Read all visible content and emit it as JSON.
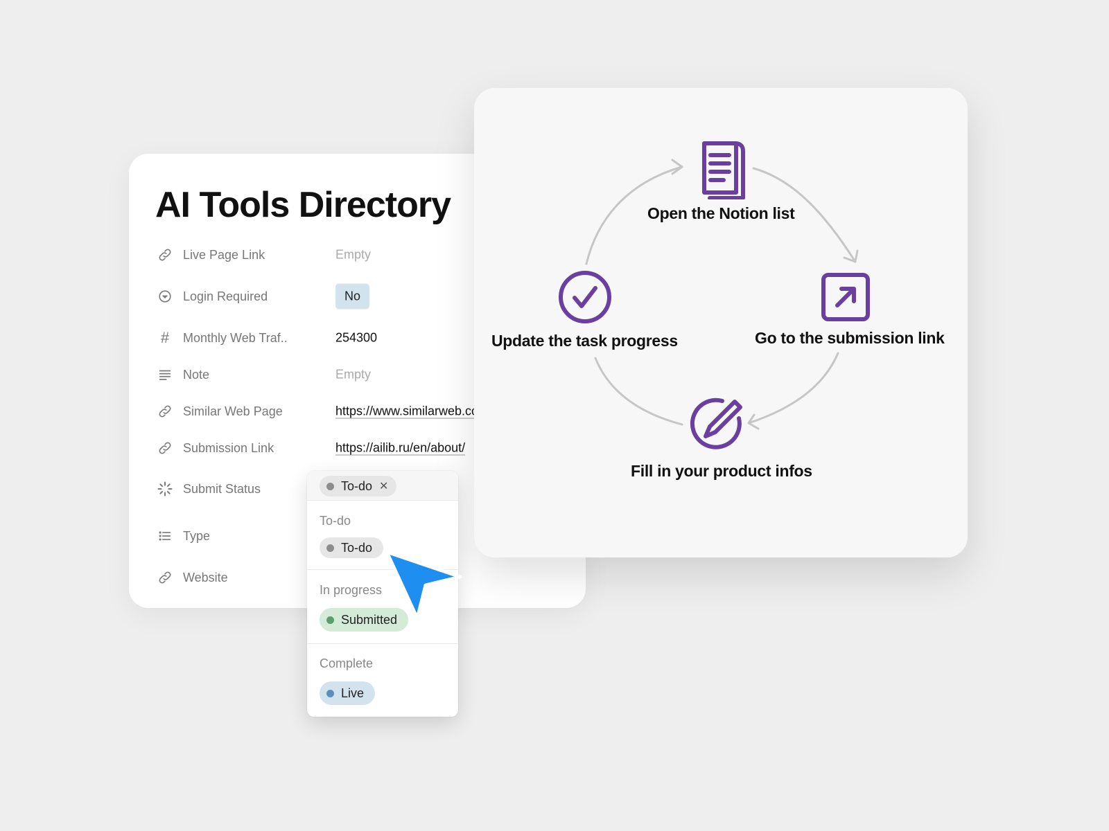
{
  "database": {
    "title": "AI Tools Directory",
    "properties": [
      {
        "icon": "link-icon",
        "label": "Live Page Link",
        "value": "Empty"
      },
      {
        "icon": "chevron-circle-icon",
        "label": "Login Required",
        "value": "No"
      },
      {
        "icon": "hash-icon",
        "label": "Monthly Web Traf..",
        "value": "254300"
      },
      {
        "icon": "text-lines-icon",
        "label": "Note",
        "value": "Empty"
      },
      {
        "icon": "link-icon",
        "label": "Similar Web Page",
        "value": "https://www.similarweb.com/website/ailib.ru/"
      },
      {
        "icon": "link-icon",
        "label": "Submission Link",
        "value": "https://ailib.ru/en/about/"
      },
      {
        "icon": "loading-status-icon",
        "label": "Submit Status",
        "value": "To-do"
      },
      {
        "icon": "list-icon",
        "label": "Type",
        "value": ""
      },
      {
        "icon": "link-icon",
        "label": "Website",
        "value": ""
      }
    ]
  },
  "status_dropdown": {
    "selected": "To-do",
    "remove_icon": "close-icon",
    "groups": [
      {
        "label": "To-do",
        "option": "To-do",
        "color": "#8d8d8d"
      },
      {
        "label": "In progress",
        "option": "Submitted",
        "color": "#5b9e6b"
      },
      {
        "label": "Complete",
        "option": "Live",
        "color": "#5a8fbf"
      }
    ]
  },
  "workflow": {
    "accent": "#6b3fa0",
    "steps": [
      {
        "label": "Open the Notion list",
        "icon": "document-icon"
      },
      {
        "label": "Go to the submission link",
        "icon": "external-link-icon"
      },
      {
        "label": "Fill in your product infos",
        "icon": "edit-pencil-icon"
      },
      {
        "label": "Update the task progress",
        "icon": "check-circle-icon"
      }
    ]
  },
  "cursor": {
    "icon": "pointer-cursor-icon",
    "color": "#1e8ef0"
  }
}
